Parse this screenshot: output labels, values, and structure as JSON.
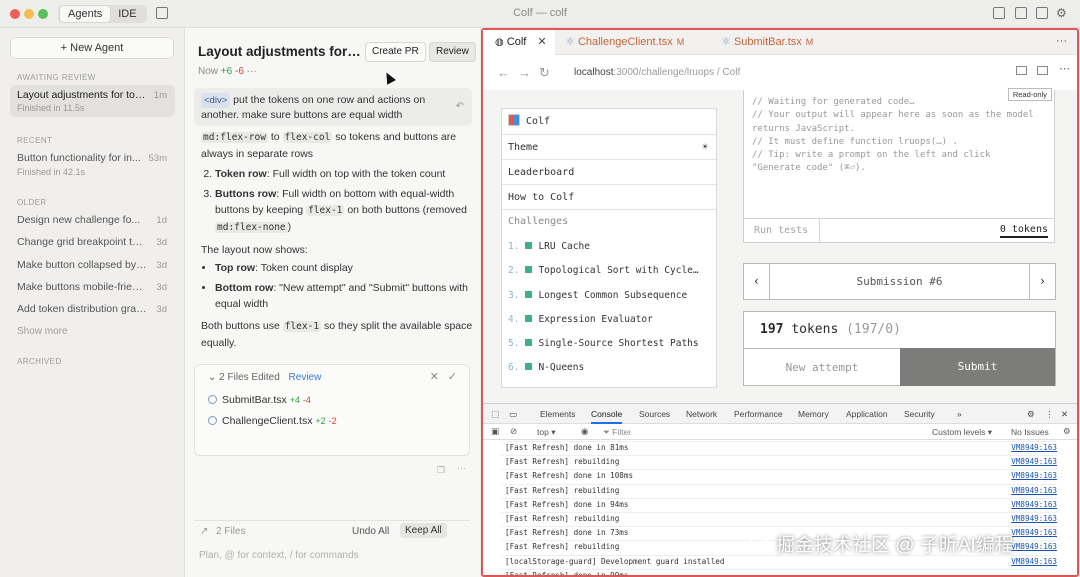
{
  "window": {
    "title": "Colf — colf",
    "mode_tabs": [
      "Agents",
      "IDE"
    ],
    "active_mode": "Agents"
  },
  "sidebar": {
    "new_agent_label": "New Agent",
    "sections": {
      "awaiting_review": "AWAITING REVIEW",
      "recent": "RECENT",
      "older": "OLDER",
      "archived": "ARCHIVED"
    },
    "awaiting": [
      {
        "title": "Layout adjustments for tok...",
        "age": "1m",
        "status": "Finished in 11.5s"
      }
    ],
    "recent": [
      {
        "title": "Button functionality for in...",
        "age": "53m",
        "status": "Finished in 42.1s"
      }
    ],
    "older": [
      {
        "title": "Design new challenge fo...",
        "age": "1d"
      },
      {
        "title": "Change grid breakpoint to l...",
        "age": "3d"
      },
      {
        "title": "Make button collapsed by d...",
        "age": "3d"
      },
      {
        "title": "Make buttons mobile-friend...",
        "age": "3d"
      },
      {
        "title": "Add token distribution grap...",
        "age": "3d"
      }
    ],
    "show_more": "Show more"
  },
  "chat": {
    "title": "Layout adjustments for t...",
    "create_pr": "Create PR",
    "review": "Review",
    "meta_time": "Now",
    "meta_plus": "+6",
    "meta_minus": "-6",
    "prompt_chip": "<div>",
    "prompt_text": "put the tokens on one row and actions on another. make sure buttons are equal width",
    "step1_code_a": "md:flex-row",
    "step1_to": "to",
    "step1_code_b": "flex-col",
    "step1_rest": "so tokens and buttons are always in separate rows",
    "step2_bold": "Token row",
    "step2_rest": ": Full width on top with the token count",
    "step3_bold": "Buttons row",
    "step3_rest_a": ": Full width on bottom with equal-width buttons by keeping",
    "step3_code_a": "flex-1",
    "step3_rest_b": "on both buttons (removed",
    "step3_code_b": "md:flex-none",
    "step3_rest_c": ")",
    "layout_intro": "The layout now shows:",
    "bullet1_bold": "Top row",
    "bullet1_rest": ": Token count display",
    "bullet2_bold": "Bottom row",
    "bullet2_rest": ": \"New attempt\" and \"Submit\" buttons with equal width",
    "outro_a": "Both buttons use",
    "outro_code": "flex-1",
    "outro_b": "so they split the available space equally.",
    "files_header": "2 Files Edited",
    "files_review": "Review",
    "files": [
      {
        "name": "SubmitBar.tsx",
        "plus": "+4",
        "minus": "-4"
      },
      {
        "name": "ChallengeClient.tsx",
        "plus": "+2",
        "minus": "-2"
      }
    ],
    "bottom_files": "2 Files",
    "undo_all": "Undo All",
    "keep_all": "Keep All",
    "input_placeholder": "Plan, @ for context, / for commands"
  },
  "browser": {
    "tabs": [
      {
        "label": "Colf",
        "mod": ""
      },
      {
        "label": "ChallengeClient.tsx",
        "mod": "M"
      },
      {
        "label": "SubmitBar.tsx",
        "mod": "M"
      }
    ],
    "url_host": "localhost",
    "url_path": ":3000/challenge/lruops / Colf"
  },
  "app": {
    "brand": "Colf",
    "theme": "Theme",
    "leaderboard": "Leaderboard",
    "how_to": "How to Colf",
    "challenges_label": "Challenges",
    "challenges": [
      {
        "n": "1.",
        "name": "LRU Cache"
      },
      {
        "n": "2.",
        "name": "Topological Sort with Cycle…"
      },
      {
        "n": "3.",
        "name": "Longest Common Subsequence"
      },
      {
        "n": "4.",
        "name": "Expression Evaluator"
      },
      {
        "n": "5.",
        "name": "Single-Source Shortest Paths"
      },
      {
        "n": "6.",
        "name": "N-Queens"
      }
    ],
    "editor_lines": [
      "// Waiting for generated code…",
      "// Your output will appear here as soon as the model",
      "returns JavaScript.",
      "// It must define function lruops(…) .",
      "// Tip: write a prompt on the left and click",
      "\"Generate code\" (⌘⏎)."
    ],
    "read_only": "Read-only",
    "run_tests": "Run tests",
    "editor_tokens": "0 tokens",
    "submission": "Submission #6",
    "token_count": "197",
    "token_word": "tokens",
    "token_detail": "(197/0)",
    "new_attempt": "New attempt",
    "submit": "Submit"
  },
  "devtools": {
    "tabs": [
      "Elements",
      "Console",
      "Sources",
      "Network",
      "Performance",
      "Memory",
      "Application",
      "Security",
      "»"
    ],
    "active": "Console",
    "context": "top",
    "filter": "Filter",
    "levels": "Custom levels",
    "issues": "No Issues",
    "logs": [
      "[Fast Refresh] done in 81ms",
      "[Fast Refresh] rebuilding",
      "[Fast Refresh] done in 108ms",
      "[Fast Refresh] rebuilding",
      "[Fast Refresh] done in 94ms",
      "[Fast Refresh] rebuilding",
      "[Fast Refresh] done in 73ms",
      "[Fast Refresh] rebuilding",
      "[localStorage-guard] Development guard installed",
      "[Fast Refresh] done in 99ms"
    ],
    "source": "VM8949:163"
  },
  "watermark": "公众号 · 子昕AI编程 · 掘金技术社区 @ 子昕AI编程",
  "watermark_visible": "掘金技术社区 @ 子昕AI编程",
  "colors": {
    "accent_red_border": "#e15555",
    "plus_green": "#2f9c3d",
    "minus_red": "#d0443a",
    "challenge_marker": "#3fae8c",
    "submit_bg": "#7c7c7a"
  }
}
